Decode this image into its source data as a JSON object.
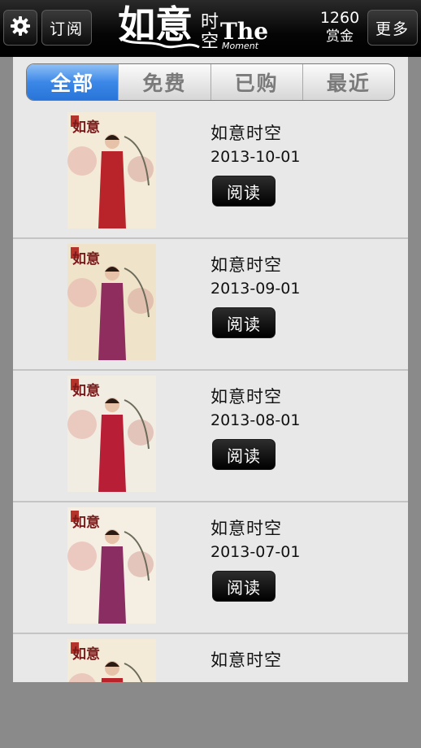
{
  "header": {
    "subscribe_label": "订阅",
    "more_label": "更多",
    "reward_amount": "1260",
    "reward_label": "赏金",
    "logo_text_main": "如意",
    "logo_text_small_top": "时",
    "logo_text_small_bottom": "空",
    "logo_text_latin": "The",
    "logo_text_latin_sub": "Moment"
  },
  "tabs": [
    {
      "label": "全部",
      "active": true
    },
    {
      "label": "免费",
      "active": false
    },
    {
      "label": "已购",
      "active": false
    },
    {
      "label": "最近",
      "active": false
    }
  ],
  "issues": [
    {
      "title": "如意时空",
      "date": "2013-10-01",
      "button": "阅读",
      "dress_color": "#b8242a",
      "bg_color": "#f3ead8"
    },
    {
      "title": "如意时空",
      "date": "2013-09-01",
      "button": "阅读",
      "dress_color": "#8e2d5e",
      "bg_color": "#efe4c9"
    },
    {
      "title": "如意时空",
      "date": "2013-08-01",
      "button": "阅读",
      "dress_color": "#b81e35",
      "bg_color": "#f2ede2"
    },
    {
      "title": "如意时空",
      "date": "2013-07-01",
      "button": "阅读",
      "dress_color": "#8a2d62",
      "bg_color": "#f5efe3"
    },
    {
      "title": "如意时空",
      "date": "",
      "button": "",
      "dress_color": "#b8242a",
      "bg_color": "#f3ead8"
    }
  ],
  "cover_masthead": "如意",
  "accent_color": "#3c88e8"
}
